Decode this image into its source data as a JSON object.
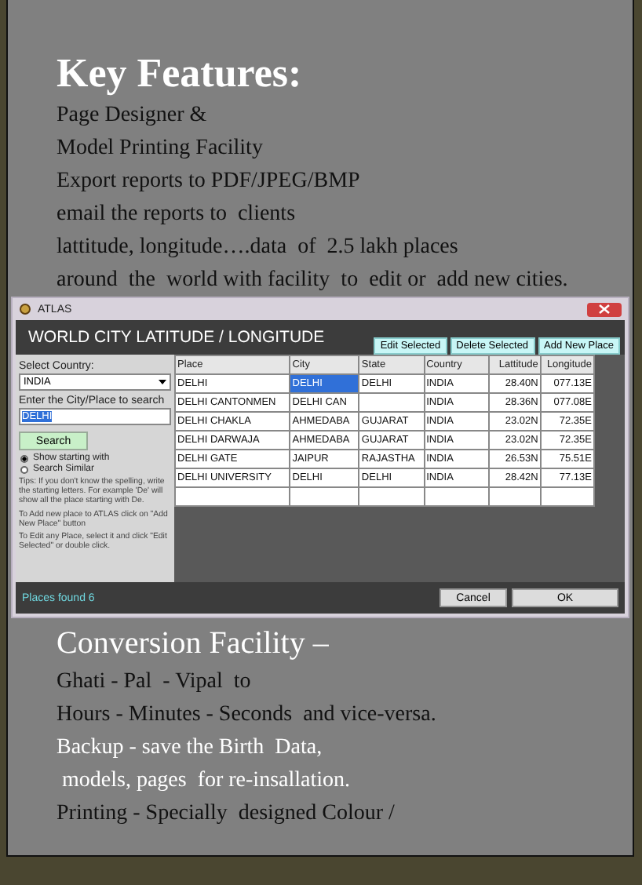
{
  "heading": "Key Features:",
  "features": [
    "Page Designer &",
    "Model Printing Facility",
    "Export reports to PDF/JPEG/BMP",
    "email the reports to  clients",
    "lattitude, longitude….data  of  2.5 lakh places",
    "around  the  world with facility  to  edit or  add new cities."
  ],
  "window": {
    "title": "ATLAS",
    "heading": "WORLD CITY LATITUDE / LONGITUDE",
    "actions": [
      "Edit Selected",
      "Delete Selected",
      "Add New Place"
    ],
    "country_label": "Select Country:",
    "country": "INDIA",
    "search_label": "Enter the City/Place to search",
    "search_value": "DELHI",
    "search_button": "Search",
    "modes": [
      {
        "label": "Show starting with",
        "selected": true
      },
      {
        "label": "Search Similar",
        "selected": false
      }
    ],
    "tips": [
      "Tips: If you don't know the spelling, write the starting letters. For example 'De' will show all the place starting with De.",
      "To Add new place to ATLAS click on \"Add New Place\" button",
      "To Edit any Place, select it and click \"Edit Selected\" or double click."
    ],
    "table": {
      "columns": [
        {
          "label": "Place",
          "kind": "text"
        },
        {
          "label": "City",
          "kind": "text"
        },
        {
          "label": "State",
          "kind": "text"
        },
        {
          "label": "Country",
          "kind": "text"
        },
        {
          "label": "Lattitude",
          "kind": "number"
        },
        {
          "label": "Longitude",
          "kind": "number"
        }
      ],
      "rows": [
        {
          "cells": [
            {
              "text": "DELHI",
              "selected": false
            },
            {
              "text": "DELHI",
              "selected": true
            },
            {
              "text": "DELHI",
              "selected": false
            },
            {
              "text": "INDIA",
              "selected": false
            },
            {
              "text": "28.40N",
              "selected": false
            },
            {
              "text": "077.13E",
              "selected": false
            }
          ]
        },
        {
          "cells": [
            {
              "text": "DELHI CANTONMEN",
              "selected": false
            },
            {
              "text": "DELHI CAN",
              "selected": false
            },
            {
              "selected": false
            },
            {
              "text": "INDIA",
              "selected": false
            },
            {
              "text": "28.36N",
              "selected": false
            },
            {
              "text": "077.08E",
              "selected": false
            }
          ]
        },
        {
          "cells": [
            {
              "text": "DELHI CHAKLA",
              "selected": false
            },
            {
              "text": "AHMEDABA",
              "selected": false
            },
            {
              "text": "GUJARAT",
              "selected": false
            },
            {
              "text": "INDIA",
              "selected": false
            },
            {
              "text": "23.02N",
              "selected": false
            },
            {
              "text": "72.35E",
              "selected": false
            }
          ]
        },
        {
          "cells": [
            {
              "text": "DELHI DARWAJA",
              "selected": false
            },
            {
              "text": "AHMEDABA",
              "selected": false
            },
            {
              "text": "GUJARAT",
              "selected": false
            },
            {
              "text": "INDIA",
              "selected": false
            },
            {
              "text": "23.02N",
              "selected": false
            },
            {
              "text": "72.35E",
              "selected": false
            }
          ]
        },
        {
          "cells": [
            {
              "text": "DELHI GATE",
              "selected": false
            },
            {
              "text": "JAIPUR",
              "selected": false
            },
            {
              "text": "RAJASTHA",
              "selected": false
            },
            {
              "text": "INDIA",
              "selected": false
            },
            {
              "text": "26.53N",
              "selected": false
            },
            {
              "text": "75.51E",
              "selected": false
            }
          ]
        },
        {
          "cells": [
            {
              "text": "DELHI UNIVERSITY",
              "selected": false
            },
            {
              "text": "DELHI",
              "selected": false
            },
            {
              "text": "DELHI",
              "selected": false
            },
            {
              "text": "INDIA",
              "selected": false
            },
            {
              "text": "28.42N",
              "selected": false
            },
            {
              "text": "77.13E",
              "selected": false
            }
          ]
        }
      ]
    },
    "status": "Places found 6",
    "buttons": [
      "Cancel",
      "OK"
    ]
  },
  "conversion": {
    "heading": "Conversion Facility –",
    "lines": [
      {
        "text": "Ghati - Pal  - Vipal  to",
        "kind": "dark"
      },
      {
        "text": "Hours - Minutes - Seconds  and vice-versa.",
        "kind": "dark"
      },
      {
        "text": "Backup - save the Birth  Data,",
        "kind": "light"
      },
      {
        "text": " models, pages  for re-insallation.",
        "kind": "light"
      },
      {
        "text": "Printing - Specially  designed Colour /",
        "kind": "dark"
      }
    ]
  }
}
